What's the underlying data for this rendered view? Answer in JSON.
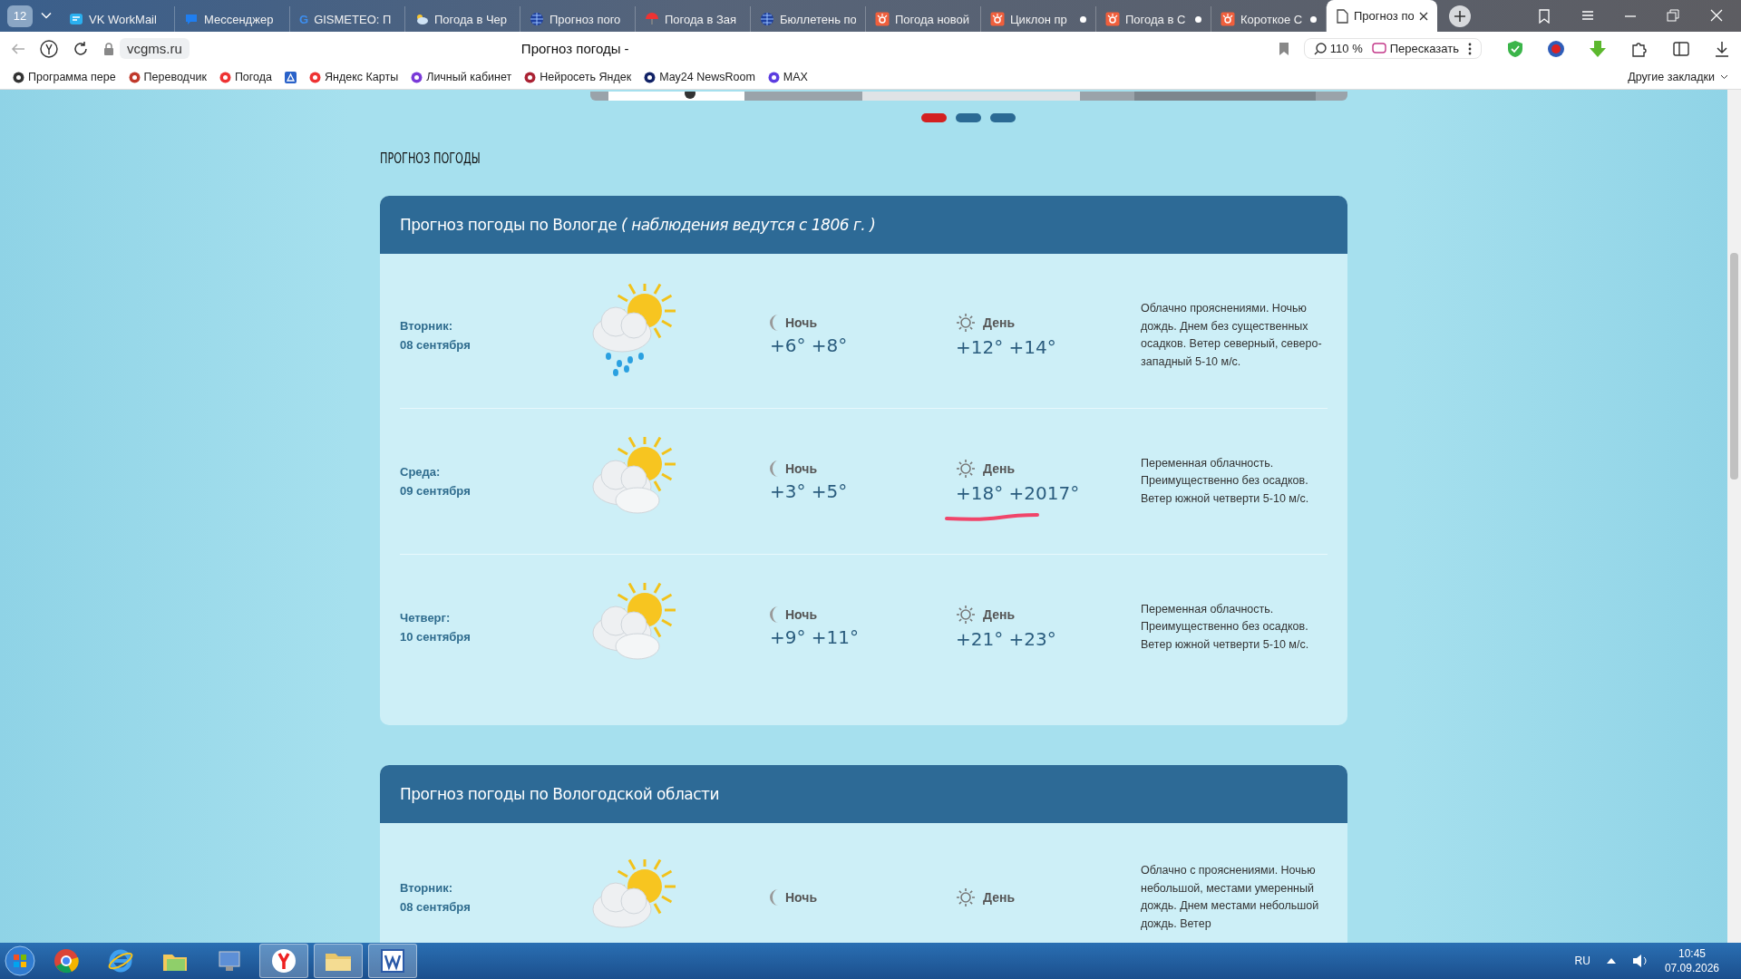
{
  "browser": {
    "tab_count": "12",
    "tabs": [
      {
        "kind": "mail",
        "title": "VK WorkMail",
        "selected": false,
        "dot": false
      },
      {
        "kind": "chat",
        "title": "Мессенджер",
        "selected": false,
        "dot": false
      },
      {
        "kind": "letter",
        "glyph": "G",
        "title": "GISMETEO: П",
        "selected": false,
        "dot": false
      },
      {
        "kind": "cloud",
        "title": "Погода в Чер",
        "selected": false,
        "dot": false
      },
      {
        "kind": "globe",
        "title": "Прогноз пого",
        "selected": false,
        "dot": false
      },
      {
        "kind": "umbrella",
        "title": "Погода в Зая",
        "selected": false,
        "dot": false
      },
      {
        "kind": "globe",
        "title": "Бюллетень по",
        "selected": false,
        "dot": false
      },
      {
        "kind": "sun",
        "title": "Погода новой",
        "selected": false,
        "dot": false
      },
      {
        "kind": "sun",
        "title": "Циклон пр",
        "selected": false,
        "dot": true
      },
      {
        "kind": "sun",
        "title": "Погода в С",
        "selected": false,
        "dot": true
      },
      {
        "kind": "sun",
        "title": "Короткое С",
        "selected": false,
        "dot": true
      },
      {
        "kind": "page",
        "title": "Прогноз по",
        "selected": true,
        "dot": false
      }
    ],
    "address": "vcgms.ru",
    "page_title": "Прогноз погоды -",
    "zoom": "110 %",
    "retell": "Пересказать",
    "bookmarks": [
      {
        "kind": "tv",
        "label": "Программа пере"
      },
      {
        "kind": "translate",
        "label": "Переводчик"
      },
      {
        "kind": "umbrella",
        "label": "Погода"
      },
      {
        "kind": "disk"
      },
      {
        "kind": "pin",
        "label": "Яндекс Карты"
      },
      {
        "kind": "ring",
        "label": "Личный кабинет"
      },
      {
        "kind": "neuro",
        "label": "Нейросеть Яндек"
      },
      {
        "kind": "news",
        "label": "May24 NewsRoom"
      },
      {
        "kind": "max",
        "label": "MAX"
      }
    ],
    "other_bookmarks": "Другие закладки"
  },
  "page": {
    "slider_dots": [
      {
        "selected": true
      },
      {
        "selected": false
      },
      {
        "selected": false
      }
    ],
    "heading": "ПРОГНОЗ ПОГОДЫ",
    "panels": [
      {
        "title": "Прогноз погоды по Вологде",
        "note": "( наблюдения ведутся с 1806 г. )",
        "days": [
          {
            "weekday": "Вторник:",
            "date": "08 сентября",
            "kind": "rain",
            "night_label": "Ночь",
            "night_temp": "+6° +8°",
            "day_label": "День",
            "day_temp": "+12° +14°",
            "description": "Облачно прояснениями. Ночью дождь. Днем без существенных осадков. Ветер северный, северо-западный 5-10 м/с."
          },
          {
            "weekday": "Среда:",
            "date": "09 сентября",
            "kind": "cloudy",
            "night_label": "Ночь",
            "night_temp": "+3° +5°",
            "day_label": "День",
            "day_temp": "+18° +2017°",
            "description": "Переменная облачность. Преимущественно без осадков. Ветер южной четверти 5-10 м/с.",
            "marked": true
          },
          {
            "weekday": "Четверг:",
            "date": "10 сентября",
            "kind": "cloudy",
            "night_label": "Ночь",
            "night_temp": "+9° +11°",
            "day_label": "День",
            "day_temp": "+21° +23°",
            "description": "Переменная облачность. Преимущественно без осадков. Ветер южной четверти 5-10 м/с."
          }
        ]
      },
      {
        "title": "Прогноз погоды по Вологодской области",
        "days": [
          {
            "weekday": "Вторник:",
            "date": "08 сентября",
            "kind": "sunny-cloud",
            "night_label": "Ночь",
            "day_label": "День",
            "description": "Облачно с прояснениями. Ночью небольшой, местами умеренный дождь. Днем местами небольшой дождь. Ветер"
          }
        ]
      }
    ]
  },
  "taskbar": {
    "apps": [
      {
        "kind": "chrome",
        "selected": false
      },
      {
        "kind": "ie",
        "selected": false
      },
      {
        "kind": "folders",
        "selected": false
      },
      {
        "kind": "monitor",
        "selected": false
      },
      {
        "kind": "yandex",
        "selected": true
      },
      {
        "kind": "explorer",
        "selected": true
      },
      {
        "kind": "word",
        "selected": true
      }
    ],
    "language": "RU",
    "time": "10:45",
    "date": "07.09.2026"
  }
}
